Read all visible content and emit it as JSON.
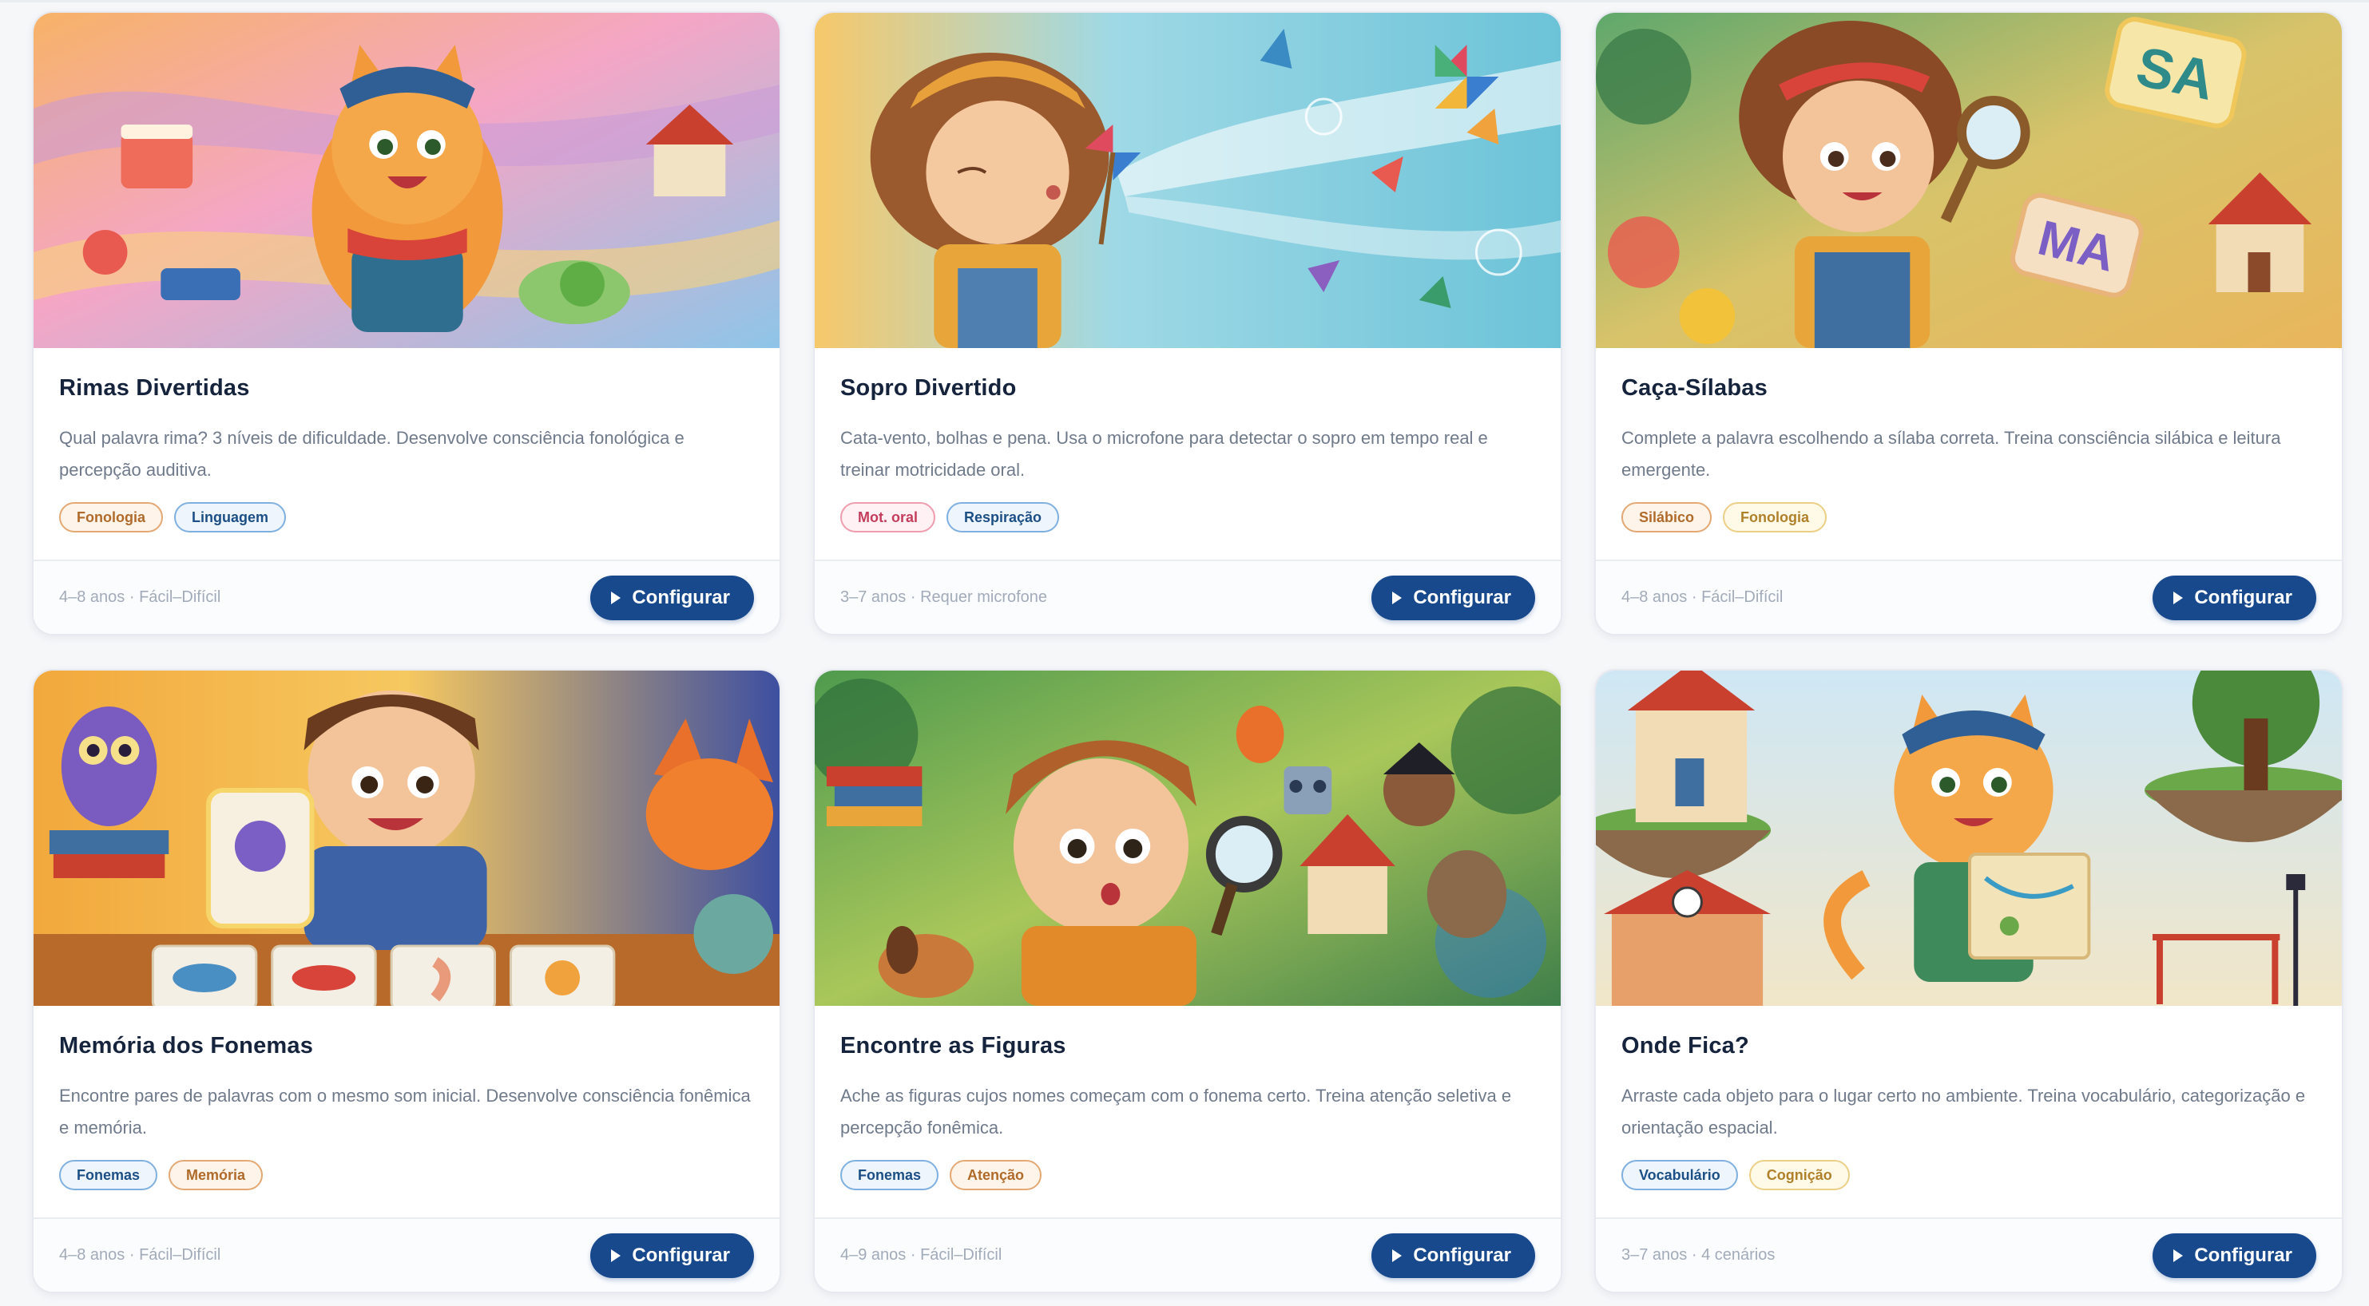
{
  "cards": [
    {
      "title": "Rimas Divertidas",
      "description": "Qual palavra rima? 3 níveis de dificuldade. Desenvolve consciência fonológica e percepção auditiva.",
      "tags": [
        {
          "label": "Fonologia",
          "color": "orange"
        },
        {
          "label": "Linguagem",
          "color": "blue"
        }
      ],
      "meta": "4–8 anos · Fácil–Difícil",
      "button": "Configurar",
      "illustration": "cat-with-rhyme-objects"
    },
    {
      "title": "Sopro Divertido",
      "description": "Cata-vento, bolhas e pena. Usa o microfone para detectar o sopro em tempo real e treinar motricidade oral.",
      "tags": [
        {
          "label": "Mot. oral",
          "color": "pink"
        },
        {
          "label": "Respiração",
          "color": "blue"
        }
      ],
      "meta": "3–7 anos · Requer microfone",
      "button": "Configurar",
      "illustration": "girl-blowing-pinwheel"
    },
    {
      "title": "Caça-Sílabas",
      "description": "Complete a palavra escolhendo a sílaba correta. Treina consciência silábica e leitura emergente.",
      "tags": [
        {
          "label": "Silábico",
          "color": "orange"
        },
        {
          "label": "Fonologia",
          "color": "yellow"
        }
      ],
      "meta": "4–8 anos · Fácil–Difícil",
      "button": "Configurar",
      "illustration": "girl-with-magnifier-syllables",
      "syllables": [
        "SA",
        "MA"
      ]
    },
    {
      "title": "Memória dos Fonemas",
      "description": "Encontre pares de palavras com o mesmo som inicial. Desenvolve consciência fonêmica e memória.",
      "tags": [
        {
          "label": "Fonemas",
          "color": "blue"
        },
        {
          "label": "Memória",
          "color": "orange"
        }
      ],
      "meta": "4–8 anos · Fácil–Difícil",
      "button": "Configurar",
      "illustration": "boy-with-memory-cards"
    },
    {
      "title": "Encontre as Figuras",
      "description": "Ache as figuras cujos nomes começam com o fonema certo. Treina atenção seletiva e percepção fonêmica.",
      "tags": [
        {
          "label": "Fonemas",
          "color": "blue"
        },
        {
          "label": "Atenção",
          "color": "orange"
        }
      ],
      "meta": "4–9 anos · Fácil–Difícil",
      "button": "Configurar",
      "illustration": "boy-searching-with-magnifier"
    },
    {
      "title": "Onde Fica?",
      "description": "Arraste cada objeto para o lugar certo no ambiente. Treina vocabulário, categorização e orientação espacial.",
      "tags": [
        {
          "label": "Vocabulário",
          "color": "blue"
        },
        {
          "label": "Cognição",
          "color": "yellow"
        }
      ],
      "meta": "3–7 anos · 4 cenários",
      "button": "Configurar",
      "illustration": "cat-with-map-floating-islands"
    }
  ]
}
